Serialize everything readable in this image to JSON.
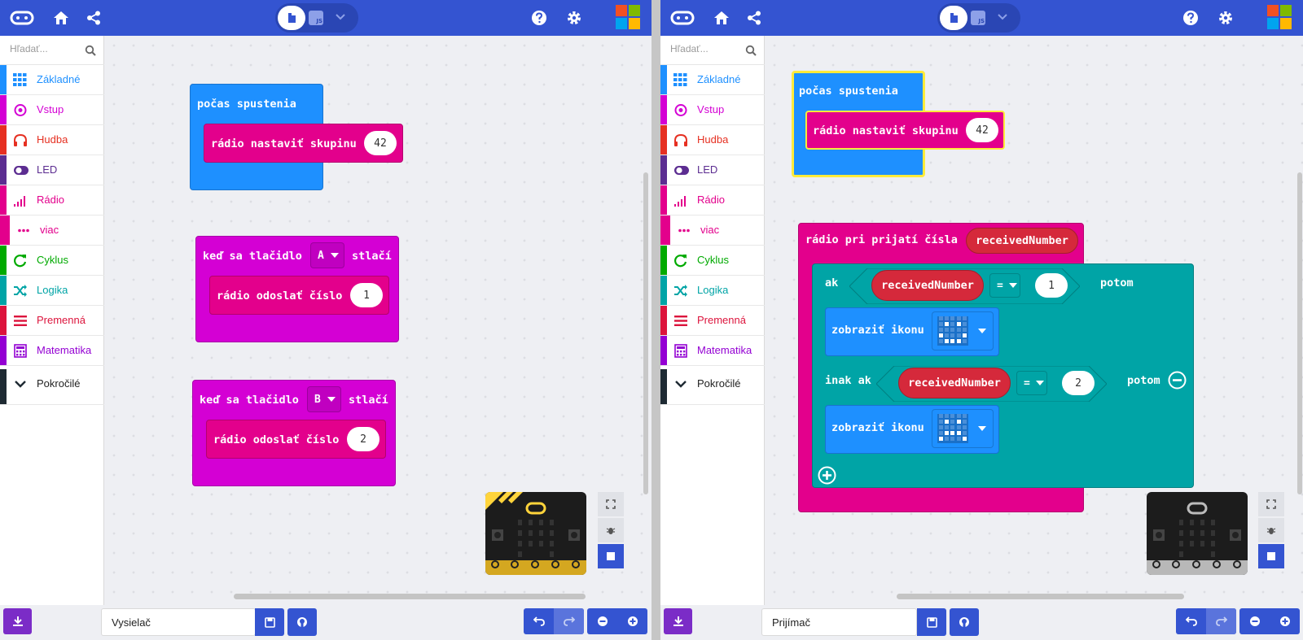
{
  "colors": {
    "topbar": "#3454d1",
    "on_start": "#1e90ff",
    "radio": "#e3008c",
    "input": "#d400d4",
    "logic": "#00a4a6",
    "variable": "#dc143c",
    "basic": "#1e90ff"
  },
  "panels": [
    {
      "id": "left",
      "search_placeholder": "Hľadať...",
      "categories": [
        {
          "label": "Základné",
          "color": "#1e90ff",
          "icon": "grid-icon"
        },
        {
          "label": "Vstup",
          "color": "#d400d4",
          "icon": "target-icon"
        },
        {
          "label": "Hudba",
          "color": "#e63022",
          "icon": "headphones-icon"
        },
        {
          "label": "LED",
          "color": "#5c2d91",
          "icon": "toggle-icon"
        },
        {
          "label": "Rádio",
          "color": "#e3008c",
          "icon": "signal-icon"
        },
        {
          "label": "viac",
          "color": "#e3008c",
          "icon": "dots-icon"
        },
        {
          "label": "Cyklus",
          "color": "#00aa00",
          "icon": "refresh-icon"
        },
        {
          "label": "Logika",
          "color": "#00a4a6",
          "icon": "shuffle-icon"
        },
        {
          "label": "Premenná",
          "color": "#dc143c",
          "icon": "list-icon"
        },
        {
          "label": "Matematika",
          "color": "#9400d3",
          "icon": "calculator-icon"
        },
        {
          "label": "Pokročilé",
          "color": "#1e2a33",
          "icon": "chevron-down-icon"
        }
      ],
      "blocks": {
        "on_start": "počas spustenia",
        "set_group": "rádio nastaviť skupinu",
        "group_value": "42",
        "button_a_prefix": "keď sa tlačidlo",
        "button_a": "A",
        "button_a_suffix": "stlačí",
        "send_a": "rádio odoslať číslo",
        "send_a_value": "1",
        "button_b_prefix": "keď sa tlačidlo",
        "button_b": "B",
        "button_b_suffix": "stlačí",
        "send_b": "rádio odoslať číslo",
        "send_b_value": "2"
      },
      "project_name": "Vysielač"
    },
    {
      "id": "right",
      "search_placeholder": "Hľadať...",
      "categories": [
        {
          "label": "Základné",
          "color": "#1e90ff",
          "icon": "grid-icon"
        },
        {
          "label": "Vstup",
          "color": "#d400d4",
          "icon": "target-icon"
        },
        {
          "label": "Hudba",
          "color": "#e63022",
          "icon": "headphones-icon"
        },
        {
          "label": "LED",
          "color": "#5c2d91",
          "icon": "toggle-icon"
        },
        {
          "label": "Rádio",
          "color": "#e3008c",
          "icon": "signal-icon"
        },
        {
          "label": "viac",
          "color": "#e3008c",
          "icon": "dots-icon"
        },
        {
          "label": "Cyklus",
          "color": "#00aa00",
          "icon": "refresh-icon"
        },
        {
          "label": "Logika",
          "color": "#00a4a6",
          "icon": "shuffle-icon"
        },
        {
          "label": "Premenná",
          "color": "#dc143c",
          "icon": "list-icon"
        },
        {
          "label": "Matematika",
          "color": "#9400d3",
          "icon": "calculator-icon"
        },
        {
          "label": "Pokročilé",
          "color": "#1e2a33",
          "icon": "chevron-down-icon"
        }
      ],
      "blocks": {
        "on_start": "počas spustenia",
        "set_group": "rádio nastaviť skupinu",
        "group_value": "42",
        "on_received": "rádio pri prijatí čísla",
        "var_name": "receivedNumber",
        "if_label": "ak",
        "cond1_var": "receivedNumber",
        "cond1_op": "=",
        "cond1_value": "1",
        "then1": "potom",
        "show_icon1": "zobraziť ikonu",
        "elif_label": "inak ak",
        "cond2_var": "receivedNumber",
        "cond2_op": "=",
        "cond2_value": "2",
        "then2": "potom",
        "show_icon2": "zobraziť ikonu"
      },
      "project_name": "Prijímač"
    }
  ]
}
